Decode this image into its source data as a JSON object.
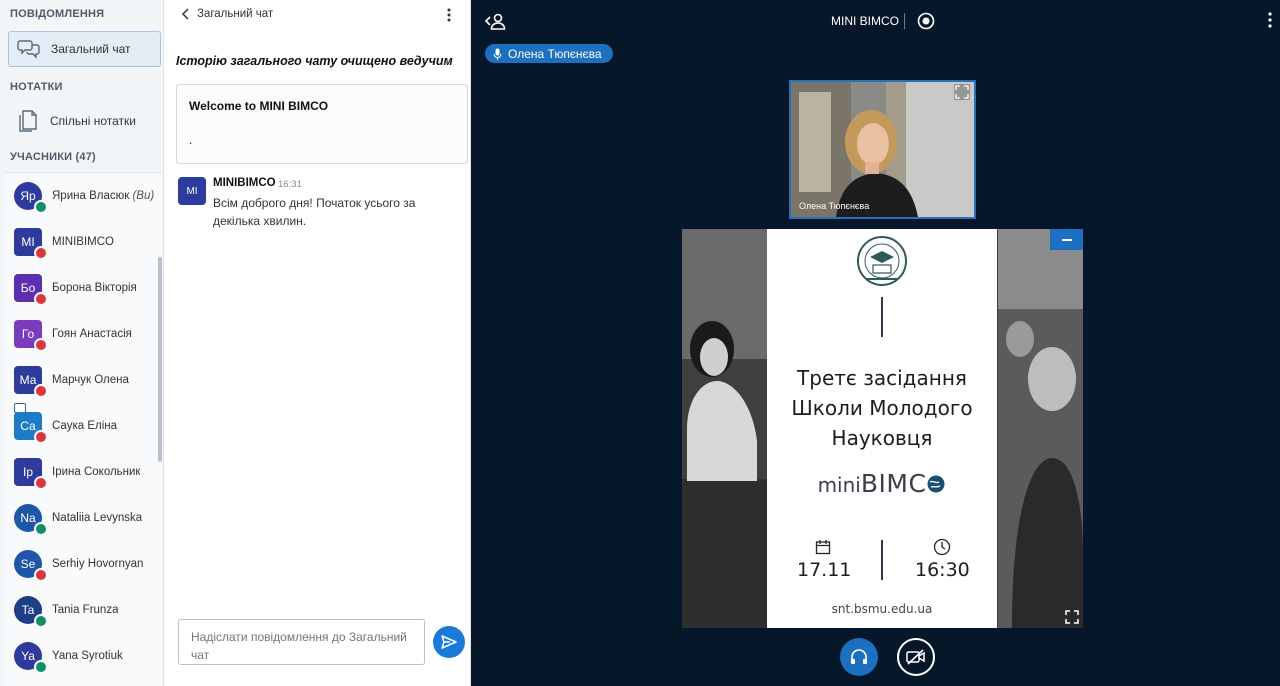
{
  "sidebar": {
    "messages_title": "ПОВІДОМЛЕННЯ",
    "public_chat_label": "Загальний чат",
    "notes_title": "НОТАТКИ",
    "shared_notes_label": "Спільні нотатки",
    "users_title": "УЧАСНИКИ (47)",
    "users": [
      {
        "initials": "Яр",
        "name": "Ярина Власюк",
        "suffix": "(Ви)",
        "color": "#2d3b9c",
        "badge": "green"
      },
      {
        "initials": "MI",
        "name": "MINIBIMCO",
        "color": "#2d3b9c",
        "badge": "red"
      },
      {
        "initials": "Бо",
        "name": "Борона Вікторія",
        "color": "#5b2fb0",
        "badge": "red"
      },
      {
        "initials": "Го",
        "name": "Гоян Анастасія",
        "color": "#7a3bbd",
        "badge": "red"
      },
      {
        "initials": "Ма",
        "name": "Марчук Олена",
        "color": "#2d3b9c",
        "badge": "red"
      },
      {
        "initials": "Са",
        "name": "Саука Еліна",
        "color": "#1f7bc7",
        "badge": "red"
      },
      {
        "initials": "Ір",
        "name": "Ірина Сокольник",
        "color": "#2d3b9c",
        "badge": "red"
      },
      {
        "initials": "Na",
        "name": "Nataliia Levynska",
        "color": "#1e56a8",
        "badge": "green"
      },
      {
        "initials": "Se",
        "name": "Serhiy Hovornyan",
        "color": "#1e56a8",
        "badge": "red"
      },
      {
        "initials": "Ta",
        "name": "Tania Frunza",
        "color": "#1e3f86",
        "badge": "green"
      },
      {
        "initials": "Ya",
        "name": "Yana Syrotiuk",
        "color": "#2d3b9c",
        "badge": "green"
      }
    ]
  },
  "chat": {
    "title": "Загальний чат",
    "cleared_notice": "Історію загального чату очищено ведучим",
    "welcome_title": "Welcome to MINI BIMCO",
    "welcome_body": ".",
    "message": {
      "avatar": "MI",
      "author": "MINIBIMCO",
      "time": "16:31",
      "text": "Всім доброго дня! Початок усього за декілька хвилин."
    },
    "input_placeholder": "Надіслати повідомлення до Загальний чат"
  },
  "main": {
    "meeting_title": "MINI BIMCO",
    "talker": "Олена Тюпєнєва",
    "webcam_name": "Олена Тюпєнєва"
  },
  "slide": {
    "line1": "Третє засідання",
    "line2": "Школи Молодого",
    "line3": "Науковця",
    "brand_mini": "mini",
    "brand_bimco": "BIMC",
    "date": "17.11",
    "time": "16:30",
    "site": "snt.bsmu.edu.ua"
  },
  "colors": {
    "accent": "#1d6fc0",
    "main_bg": "#06172a",
    "sidebar_bg": "#f3f6f9"
  },
  "icons": [
    "chat-icon",
    "notes-icon",
    "back-icon",
    "kebab-icon",
    "leave-icon",
    "record-icon",
    "microphone-icon",
    "send-icon",
    "headphones-icon",
    "camera-off-icon",
    "expand-icon",
    "minimize-icon",
    "calendar-icon",
    "clock-icon",
    "globe-icon"
  ]
}
